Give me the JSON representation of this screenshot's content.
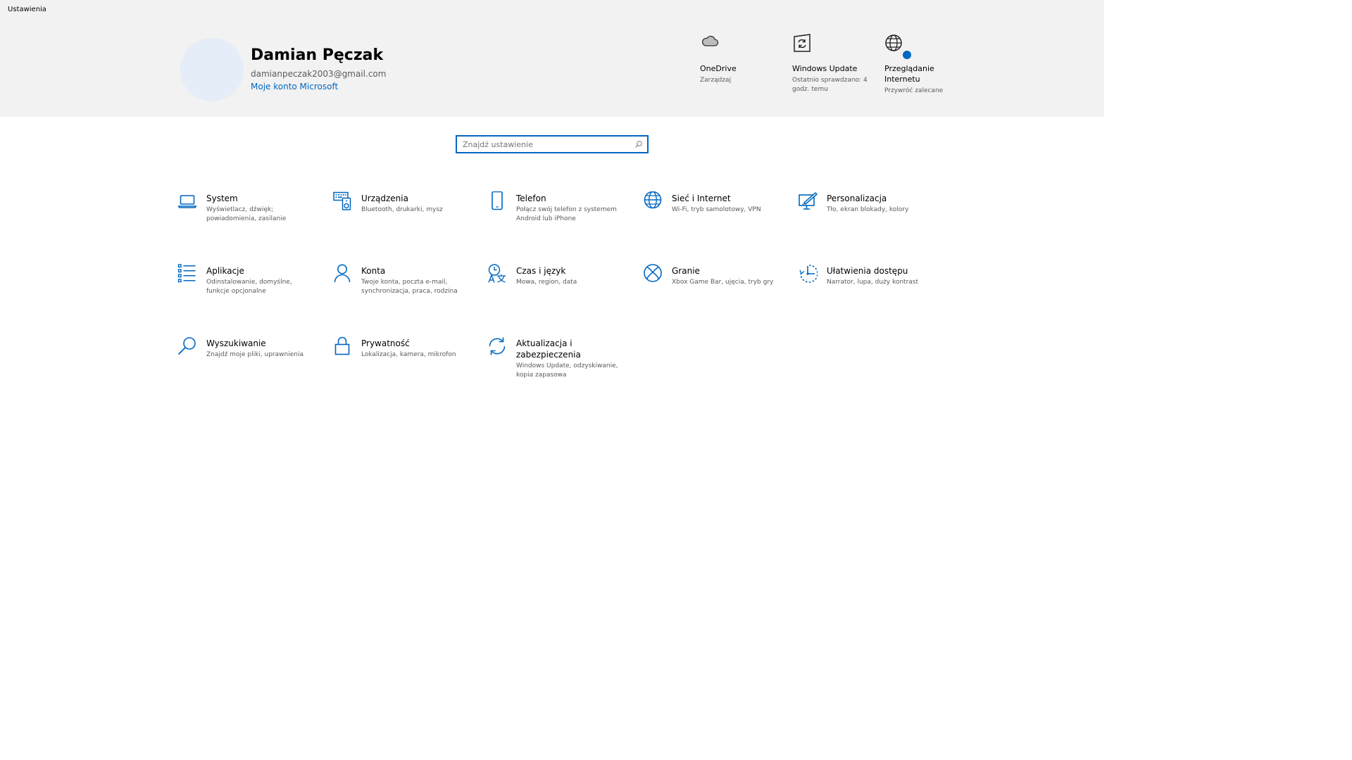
{
  "window": {
    "title": "Ustawienia"
  },
  "profile": {
    "name": "Damian Pęczak",
    "email": "damianpeczak2003@gmail.com",
    "account_link": "Moje konto Microsoft"
  },
  "quick_links": [
    {
      "icon": "cloud-icon",
      "title": "OneDrive",
      "subtitle": "Zarządzaj"
    },
    {
      "icon": "windows-update-icon",
      "title": "Windows Update",
      "subtitle": "Ostatnio sprawdzano: 4 godz. temu"
    },
    {
      "icon": "globe-icon",
      "title": "Przeglądanie Internetu",
      "subtitle": "Przywróć zalecane"
    }
  ],
  "search": {
    "placeholder": "Znajdź ustawienie",
    "value": ""
  },
  "categories": [
    {
      "icon": "laptop-icon",
      "title": "System",
      "subtitle": "Wyświetlacz, dźwięk; powiadomienia, zasilanie"
    },
    {
      "icon": "devices-icon",
      "title": "Urządzenia",
      "subtitle": "Bluetooth, drukarki, mysz"
    },
    {
      "icon": "phone-icon",
      "title": "Telefon",
      "subtitle": "Połącz swój telefon z systemem Android lub iPhone"
    },
    {
      "icon": "network-icon",
      "title": "Sieć i Internet",
      "subtitle": "Wi-Fi, tryb samolotowy, VPN"
    },
    {
      "icon": "personalization-icon",
      "title": "Personalizacja",
      "subtitle": "Tło, ekran blokady, kolory"
    },
    {
      "icon": "apps-icon",
      "title": "Aplikacje",
      "subtitle": "Odinstalowanie, domyślne, funkcje opcjonalne"
    },
    {
      "icon": "accounts-icon",
      "title": "Konta",
      "subtitle": "Twoje konta, poczta e-mail, synchronizacja, praca, rodzina"
    },
    {
      "icon": "time-language-icon",
      "title": "Czas i język",
      "subtitle": "Mowa, region, data"
    },
    {
      "icon": "xbox-icon",
      "title": "Granie",
      "subtitle": "Xbox Game Bar, ujęcia, tryb gry"
    },
    {
      "icon": "accessibility-icon",
      "title": "Ułatwienia dostępu",
      "subtitle": "Narrator, lupa, duży kontrast"
    },
    {
      "icon": "search-icon",
      "title": "Wyszukiwanie",
      "subtitle": "Znajdź moje pliki, uprawnienia"
    },
    {
      "icon": "lock-icon",
      "title": "Prywatność",
      "subtitle": "Lokalizacja, kamera, mikrofon"
    },
    {
      "icon": "update-security-icon",
      "title": "Aktualizacja i zabezpieczenia",
      "subtitle": "Windows Update, odzyskiwanie, kopia zapasowa"
    }
  ],
  "colors": {
    "accent": "#0067c0",
    "header_bg": "#f2f2f2",
    "avatar_bg": "#e5edf8"
  }
}
